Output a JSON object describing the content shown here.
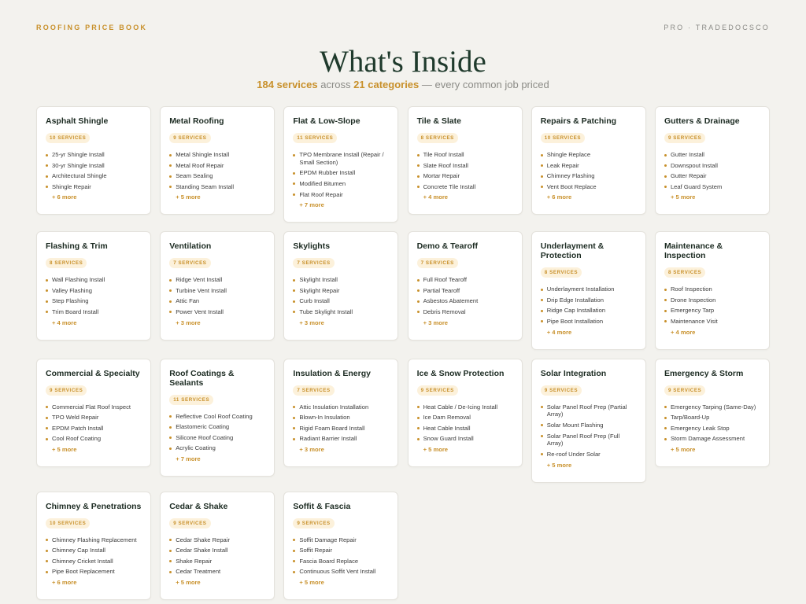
{
  "header": {
    "brand": "ROOFING PRICE BOOK",
    "pro": "PRO · TRADEDOCSCO"
  },
  "hero": {
    "title": "What's Inside",
    "services_count": "184 services",
    "across": "across",
    "categories_count": "21 categories",
    "tail": "— every common job priced"
  },
  "colors": {
    "accent": "#c8902a",
    "title": "#1f3a2c",
    "background": "#f3f2ee"
  },
  "categories": [
    {
      "title": "Asphalt Shingle",
      "badge": "10 SERVICES",
      "items": [
        "25-yr Shingle Install",
        "30-yr Shingle Install",
        "Architectural Shingle",
        "Shingle Repair"
      ],
      "more": "+ 6 more"
    },
    {
      "title": "Metal Roofing",
      "badge": "9 SERVICES",
      "items": [
        "Metal Shingle Install",
        "Metal Roof Repair",
        "Seam Sealing",
        "Standing Seam Install"
      ],
      "more": "+ 5 more"
    },
    {
      "title": "Flat & Low-Slope",
      "badge": "11 SERVICES",
      "items": [
        "TPO Membrane Install (Repair / Small Section)",
        "EPDM Rubber Install",
        "Modified Bitumen",
        "Flat Roof Repair"
      ],
      "more": "+ 7 more"
    },
    {
      "title": "Tile & Slate",
      "badge": "8 SERVICES",
      "items": [
        "Tile Roof Install",
        "Slate Roof Install",
        "Mortar Repair",
        "Concrete Tile Install"
      ],
      "more": "+ 4 more"
    },
    {
      "title": "Repairs & Patching",
      "badge": "10 SERVICES",
      "items": [
        "Shingle Replace",
        "Leak Repair",
        "Chimney Flashing",
        "Vent Boot Replace"
      ],
      "more": "+ 6 more"
    },
    {
      "title": "Gutters & Drainage",
      "badge": "9 SERVICES",
      "items": [
        "Gutter Install",
        "Downspout Install",
        "Gutter Repair",
        "Leaf Guard System"
      ],
      "more": "+ 5 more"
    },
    {
      "title": "Flashing & Trim",
      "badge": "8 SERVICES",
      "items": [
        "Wall Flashing Install",
        "Valley Flashing",
        "Step Flashing",
        "Trim Board Install"
      ],
      "more": "+ 4 more"
    },
    {
      "title": "Ventilation",
      "badge": "7 SERVICES",
      "items": [
        "Ridge Vent Install",
        "Turbine Vent Install",
        "Attic Fan",
        "Power Vent Install"
      ],
      "more": "+ 3 more"
    },
    {
      "title": "Skylights",
      "badge": "7 SERVICES",
      "items": [
        "Skylight Install",
        "Skylight Repair",
        "Curb Install",
        "Tube Skylight Install"
      ],
      "more": "+ 3 more"
    },
    {
      "title": "Demo & Tearoff",
      "badge": "7 SERVICES",
      "items": [
        "Full Roof Tearoff",
        "Partial Tearoff",
        "Asbestos Abatement",
        "Debris Removal"
      ],
      "more": "+ 3 more"
    },
    {
      "title": "Underlayment & Protection",
      "badge": "8 SERVICES",
      "items": [
        "Underlayment Installation",
        "Drip Edge Installation",
        "Ridge Cap Installation",
        "Pipe Boot Installation"
      ],
      "more": "+ 4 more"
    },
    {
      "title": "Maintenance & Inspection",
      "badge": "8 SERVICES",
      "items": [
        "Roof Inspection",
        "Drone Inspection",
        "Emergency Tarp",
        "Maintenance Visit"
      ],
      "more": "+ 4 more"
    },
    {
      "title": "Commercial & Specialty",
      "badge": "9 SERVICES",
      "items": [
        "Commercial Flat Roof Inspect",
        "TPO Weld Repair",
        "EPDM Patch Install",
        "Cool Roof Coating"
      ],
      "more": "+ 5 more"
    },
    {
      "title": "Roof Coatings & Sealants",
      "badge": "11 SERVICES",
      "items": [
        "Reflective Cool Roof Coating",
        "Elastomeric Coating",
        "Silicone Roof Coating",
        "Acrylic Coating"
      ],
      "more": "+ 7 more"
    },
    {
      "title": "Insulation & Energy",
      "badge": "7 SERVICES",
      "items": [
        "Attic Insulation Installation",
        "Blown-In Insulation",
        "Rigid Foam Board Install",
        "Radiant Barrier Install"
      ],
      "more": "+ 3 more"
    },
    {
      "title": "Ice & Snow Protection",
      "badge": "9 SERVICES",
      "items": [
        "Heat Cable / De-Icing Install",
        "Ice Dam Removal",
        "Heat Cable Install",
        "Snow Guard Install"
      ],
      "more": "+ 5 more"
    },
    {
      "title": "Solar Integration",
      "badge": "9 SERVICES",
      "items": [
        "Solar Panel Roof Prep (Partial Array)",
        "Solar Mount Flashing",
        "Solar Panel Roof Prep (Full Array)",
        "Re-roof Under Solar"
      ],
      "more": "+ 5 more"
    },
    {
      "title": "Emergency & Storm",
      "badge": "9 SERVICES",
      "items": [
        "Emergency Tarping (Same-Day)",
        "Tarp/Board-Up",
        "Emergency Leak Stop",
        "Storm Damage Assessment"
      ],
      "more": "+ 5 more"
    },
    {
      "title": "Chimney & Penetrations",
      "badge": "10 SERVICES",
      "items": [
        "Chimney Flashing Replacement",
        "Chimney Cap Install",
        "Chimney Cricket Install",
        "Pipe Boot Replacement"
      ],
      "more": "+ 6 more"
    },
    {
      "title": "Cedar & Shake",
      "badge": "9 SERVICES",
      "items": [
        "Cedar Shake Repair",
        "Cedar Shake Install",
        "Shake Repair",
        "Cedar Treatment"
      ],
      "more": "+ 5 more"
    },
    {
      "title": "Soffit & Fascia",
      "badge": "9 SERVICES",
      "items": [
        "Soffit Damage Repair",
        "Soffit Repair",
        "Fascia Board Replace",
        "Continuous Soffit Vent Install"
      ],
      "more": "+ 5 more"
    }
  ]
}
